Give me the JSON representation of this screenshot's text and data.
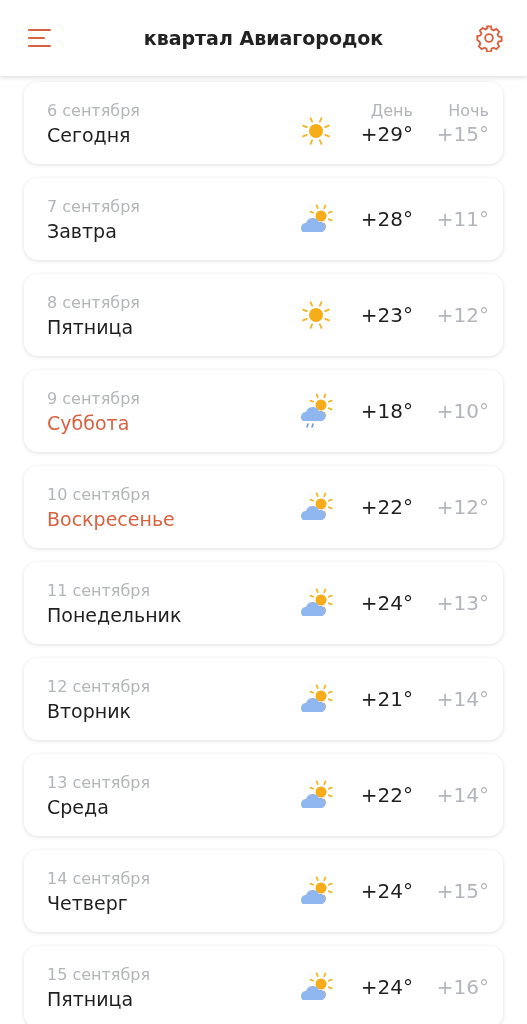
{
  "header": {
    "title": "квартал Авиагородок"
  },
  "columns": {
    "day": "День",
    "night": "Ночь"
  },
  "days": [
    {
      "date": "6 сентября",
      "name": "Сегодня",
      "weekend": false,
      "kind": "sunny",
      "day": "+29°",
      "night": "+15°"
    },
    {
      "date": "7 сентября",
      "name": "Завтра",
      "weekend": false,
      "kind": "partly_cloudy",
      "day": "+28°",
      "night": "+11°"
    },
    {
      "date": "8 сентября",
      "name": "Пятница",
      "weekend": false,
      "kind": "sunny",
      "day": "+23°",
      "night": "+12°"
    },
    {
      "date": "9 сентября",
      "name": "Суббота",
      "weekend": true,
      "kind": "rain",
      "day": "+18°",
      "night": "+10°"
    },
    {
      "date": "10 сентября",
      "name": "Воскресенье",
      "weekend": true,
      "kind": "partly_cloudy",
      "day": "+22°",
      "night": "+12°"
    },
    {
      "date": "11 сентября",
      "name": "Понедельник",
      "weekend": false,
      "kind": "partly_cloudy",
      "day": "+24°",
      "night": "+13°"
    },
    {
      "date": "12 сентября",
      "name": "Вторник",
      "weekend": false,
      "kind": "partly_cloudy",
      "day": "+21°",
      "night": "+14°"
    },
    {
      "date": "13 сентября",
      "name": "Среда",
      "weekend": false,
      "kind": "partly_cloudy",
      "day": "+22°",
      "night": "+14°"
    },
    {
      "date": "14 сентября",
      "name": "Четверг",
      "weekend": false,
      "kind": "partly_cloudy",
      "day": "+24°",
      "night": "+15°"
    },
    {
      "date": "15 сентября",
      "name": "Пятница",
      "weekend": false,
      "kind": "partly_cloudy",
      "day": "+24°",
      "night": "+16°"
    }
  ]
}
